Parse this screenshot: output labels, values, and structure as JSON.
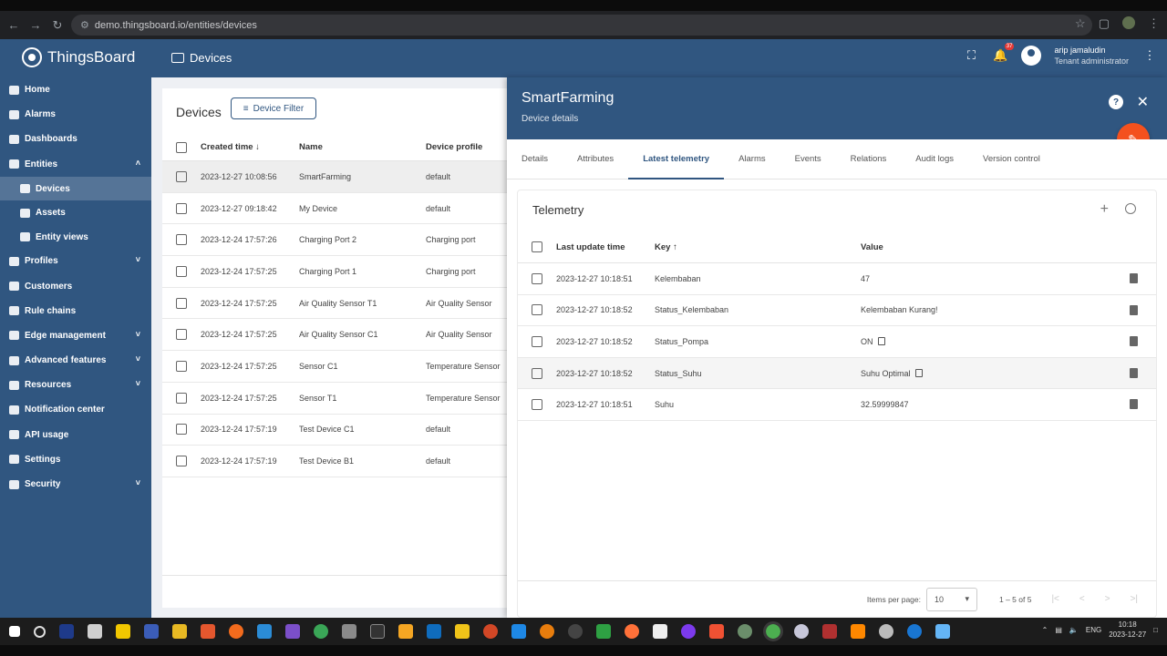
{
  "browser": {
    "url": "demo.thingsboard.io/entities/devices"
  },
  "app": {
    "brand": "ThingsBoard",
    "breadcrumb": "Devices",
    "notification_count": "37",
    "user_name": "arip jamaludin",
    "user_role": "Tenant administrator"
  },
  "sidebar": {
    "items": [
      {
        "label": "Home",
        "icon": "home-icon",
        "chevron": ""
      },
      {
        "label": "Alarms",
        "icon": "alarm-icon",
        "chevron": ""
      },
      {
        "label": "Dashboards",
        "icon": "dashboard-icon",
        "chevron": ""
      },
      {
        "label": "Entities",
        "icon": "entities-icon",
        "chevron": "^"
      },
      {
        "label": "Devices",
        "icon": "device-icon",
        "chevron": "",
        "sub": true,
        "active": true
      },
      {
        "label": "Assets",
        "icon": "asset-icon",
        "chevron": "",
        "sub": true
      },
      {
        "label": "Entity views",
        "icon": "entity-view-icon",
        "chevron": "",
        "sub": true
      },
      {
        "label": "Profiles",
        "icon": "profiles-icon",
        "chevron": "v"
      },
      {
        "label": "Customers",
        "icon": "customers-icon",
        "chevron": ""
      },
      {
        "label": "Rule chains",
        "icon": "rule-chain-icon",
        "chevron": ""
      },
      {
        "label": "Edge management",
        "icon": "edge-icon",
        "chevron": "v"
      },
      {
        "label": "Advanced features",
        "icon": "advanced-icon",
        "chevron": "v"
      },
      {
        "label": "Resources",
        "icon": "resources-icon",
        "chevron": "v"
      },
      {
        "label": "Notification center",
        "icon": "notification-icon",
        "chevron": ""
      },
      {
        "label": "API usage",
        "icon": "api-icon",
        "chevron": ""
      },
      {
        "label": "Settings",
        "icon": "settings-icon",
        "chevron": ""
      },
      {
        "label": "Security",
        "icon": "security-icon",
        "chevron": "v"
      }
    ]
  },
  "device_list": {
    "title": "Devices",
    "filter_label": "Device Filter",
    "columns": [
      "Created time ↓",
      "Name",
      "Device profile"
    ],
    "rows": [
      {
        "time": "2023-12-27 10:08:56",
        "name": "SmartFarming",
        "profile": "default"
      },
      {
        "time": "2023-12-27 09:18:42",
        "name": "My Device",
        "profile": "default"
      },
      {
        "time": "2023-12-24 17:57:26",
        "name": "Charging Port 2",
        "profile": "Charging port"
      },
      {
        "time": "2023-12-24 17:57:25",
        "name": "Charging Port 1",
        "profile": "Charging port"
      },
      {
        "time": "2023-12-24 17:57:25",
        "name": "Air Quality Sensor T1",
        "profile": "Air Quality Sensor"
      },
      {
        "time": "2023-12-24 17:57:25",
        "name": "Air Quality Sensor C1",
        "profile": "Air Quality Sensor"
      },
      {
        "time": "2023-12-24 17:57:25",
        "name": "Sensor C1",
        "profile": "Temperature Sensor"
      },
      {
        "time": "2023-12-24 17:57:25",
        "name": "Sensor T1",
        "profile": "Temperature Sensor"
      },
      {
        "time": "2023-12-24 17:57:19",
        "name": "Test Device C1",
        "profile": "default"
      },
      {
        "time": "2023-12-24 17:57:19",
        "name": "Test Device B1",
        "profile": "default"
      }
    ]
  },
  "details": {
    "title": "SmartFarming",
    "subtitle": "Device details",
    "tabs": [
      "Details",
      "Attributes",
      "Latest telemetry",
      "Alarms",
      "Events",
      "Relations",
      "Audit logs",
      "Version control"
    ],
    "active_tab": "Latest telemetry",
    "telemetry": {
      "title": "Telemetry",
      "columns": [
        "Last update time",
        "Key ↑",
        "Value"
      ],
      "rows": [
        {
          "time": "2023-12-27 10:18:51",
          "key": "Kelembaban",
          "value": "47",
          "copy": false
        },
        {
          "time": "2023-12-27 10:18:52",
          "key": "Status_Kelembaban",
          "value": "Kelembaban Kurang!",
          "copy": false
        },
        {
          "time": "2023-12-27 10:18:52",
          "key": "Status_Pompa",
          "value": "ON",
          "copy": true
        },
        {
          "time": "2023-12-27 10:18:52",
          "key": "Status_Suhu",
          "value": "Suhu Optimal",
          "copy": true
        },
        {
          "time": "2023-12-27 10:18:51",
          "key": "Suhu",
          "value": "32.59999847",
          "copy": false
        }
      ],
      "items_per_page_label": "Items per page:",
      "items_per_page": "10",
      "range": "1 – 5 of 5"
    }
  },
  "taskbar": {
    "language": "ENG",
    "time": "10:18",
    "date": "2023-12-27"
  }
}
